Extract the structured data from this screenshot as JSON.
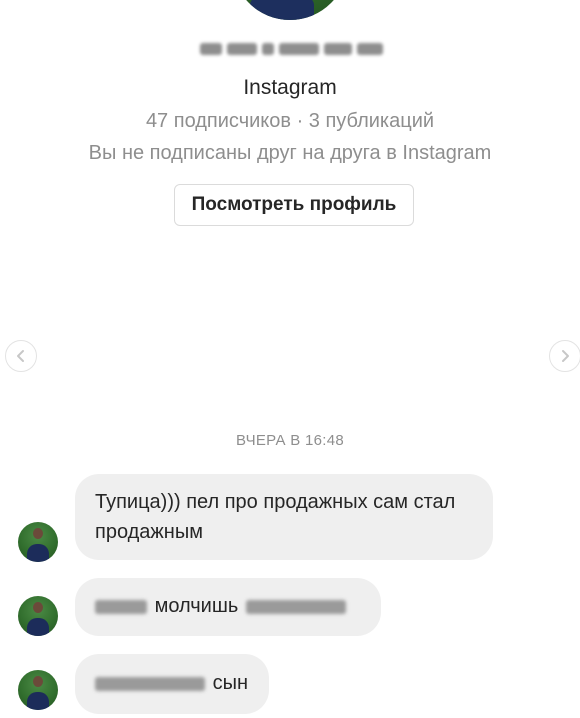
{
  "profile": {
    "platform": "Instagram",
    "stats": "47 подписчиков · 3 публикаций",
    "relation": "Вы не подписаны друг на друга в Instagram",
    "view_profile_label": "Посмотреть профиль"
  },
  "icons": {
    "left": "chevron-left-icon",
    "right": "chevron-right-icon"
  },
  "timestamp": "ВЧЕРА В 16:48",
  "messages": [
    {
      "text": "Тупица))) пел про продажных сам стал продажным"
    },
    {
      "text": "молчишь"
    },
    {
      "text": "сын"
    }
  ]
}
